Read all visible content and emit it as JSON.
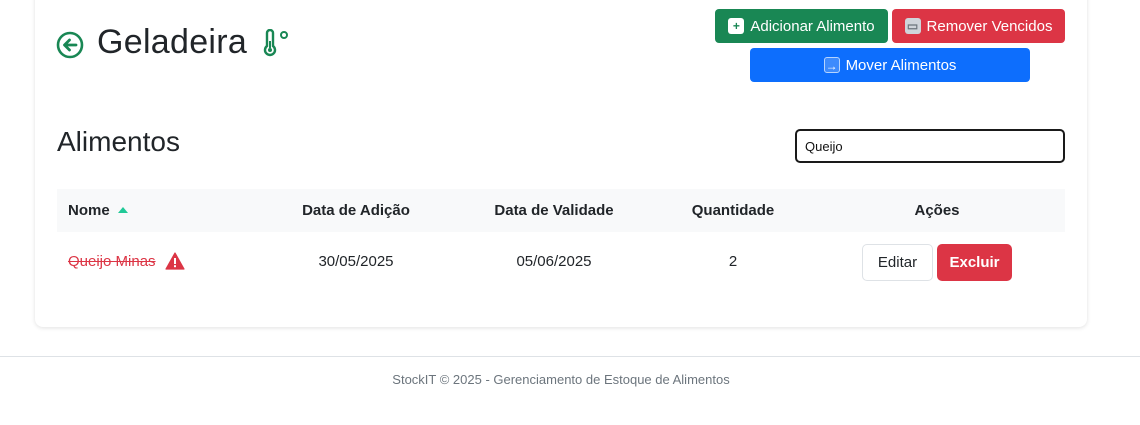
{
  "header": {
    "title": "Geladeira",
    "back_icon": "arrow-left-circle-icon",
    "title_icon": "thermometer-icon",
    "accent_color": "#198754"
  },
  "actions": {
    "add_label": "Adicionar Alimento",
    "add_icon": "plus-emoji-icon",
    "remove_label": "Remover Vencidos",
    "remove_icon": "trash-emoji-icon",
    "move_label": "Mover Alimentos",
    "move_icon": "arrow-right-emoji-icon"
  },
  "section": {
    "title": "Alimentos"
  },
  "search": {
    "value": "Queijo"
  },
  "table": {
    "columns": [
      "Nome",
      "Data de Adição",
      "Data de Validade",
      "Quantidade",
      "Ações"
    ],
    "sort_column": "Nome",
    "sort_direction": "ascending",
    "rows": [
      {
        "name": "Queijo Minas",
        "added": "30/05/2025",
        "expiry": "05/06/2025",
        "quantity": "2",
        "expired": true,
        "status_icon": "warning-triangle-icon",
        "edit_label": "Editar",
        "delete_label": "Excluir"
      }
    ]
  },
  "footer": {
    "text": "StockIT © 2025 - Gerenciamento de Estoque de Alimentos"
  }
}
